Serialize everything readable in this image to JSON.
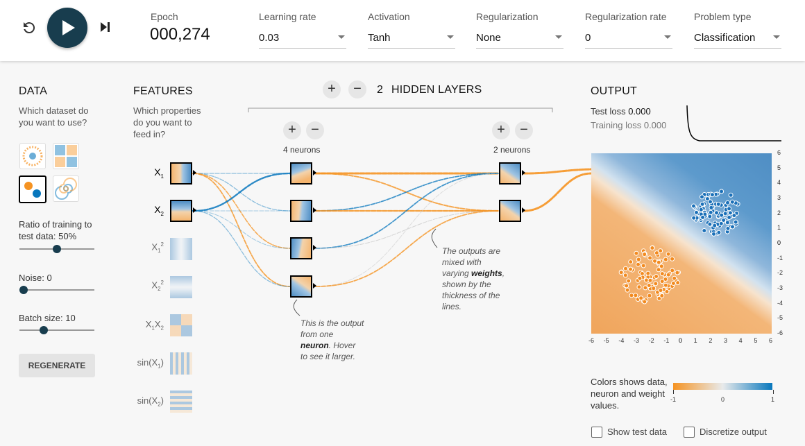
{
  "controls": {
    "epoch_label": "Epoch",
    "epoch_value": "000,274",
    "learning_rate": {
      "label": "Learning rate",
      "value": "0.03"
    },
    "activation": {
      "label": "Activation",
      "value": "Tanh"
    },
    "regularization": {
      "label": "Regularization",
      "value": "None"
    },
    "regularization_rate": {
      "label": "Regularization rate",
      "value": "0"
    },
    "problem_type": {
      "label": "Problem type",
      "value": "Classification"
    }
  },
  "data_panel": {
    "title": "DATA",
    "subtitle": "Which dataset do you want to use?",
    "ratio_label": "Ratio of training to test data:",
    "ratio_value": "50%",
    "ratio_fraction": 0.5,
    "noise_label": "Noise:",
    "noise_value": "0",
    "noise_fraction": 0.0,
    "batch_label": "Batch size:",
    "batch_value": "10",
    "batch_fraction": 0.3,
    "regenerate_label": "REGENERATE"
  },
  "features_panel": {
    "title": "FEATURES",
    "subtitle": "Which properties do you want to feed in?"
  },
  "network": {
    "hidden_layers_count": "2",
    "hidden_layers_label": "HIDDEN LAYERS",
    "plus": "+",
    "minus": "−",
    "layer1_neurons_label": "4 neurons",
    "layer2_neurons_label": "2 neurons",
    "note_neuron": "This is the output from one neuron. Hover to see it larger.",
    "note_neuron_bold": "neuron",
    "note_weights": "The outputs are mixed with varying weights, shown by the thickness of the lines.",
    "note_weights_bold": "weights"
  },
  "output_panel": {
    "title": "OUTPUT",
    "test_loss_label": "Test loss",
    "test_loss_value": "0.000",
    "training_loss_label": "Training loss",
    "training_loss_value": "0.000",
    "x_ticks": [
      "-6",
      "-5",
      "-4",
      "-3",
      "-2",
      "-1",
      "0",
      "1",
      "2",
      "3",
      "4",
      "5",
      "6"
    ],
    "y_ticks": [
      "6",
      "5",
      "4",
      "3",
      "2",
      "1",
      "0",
      "-1",
      "-2",
      "-3",
      "-4",
      "-5",
      "-6"
    ],
    "legend_text": "Colors shows data, neuron and weight values.",
    "legend_ticks": [
      "-1",
      "0",
      "1"
    ],
    "show_test_data_label": "Show test data",
    "discretize_output_label": "Discretize output"
  },
  "colors": {
    "orange": "#f59322",
    "blue": "#0877bd",
    "dark": "#183d4e"
  }
}
